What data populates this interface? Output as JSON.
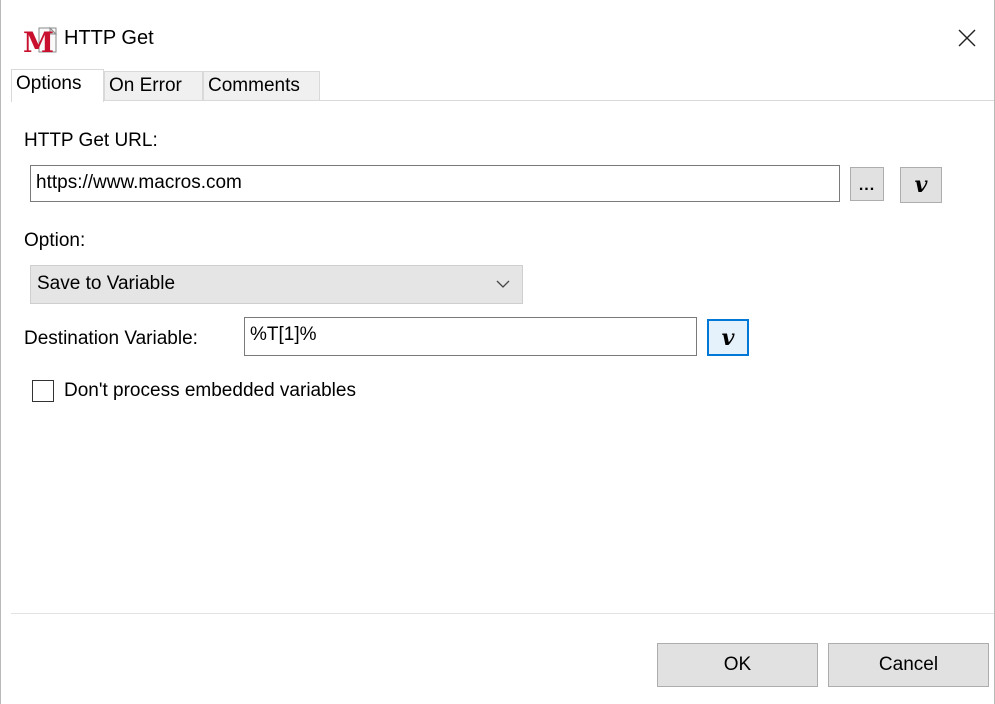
{
  "window": {
    "title": "HTTP Get",
    "app_icon": "macro-m-icon"
  },
  "tabs": [
    {
      "label": "Options",
      "active": true
    },
    {
      "label": "On Error",
      "active": false
    },
    {
      "label": "Comments",
      "active": false
    }
  ],
  "options": {
    "url_label": "HTTP Get URL:",
    "url_value": "https://www.macros.com",
    "browse_button": "...",
    "variable_button": "v",
    "option_label": "Option:",
    "option_selected": "Save to Variable",
    "dest_label": "Destination Variable:",
    "dest_value": "%T[1]%",
    "checkbox_label": "Don't process embedded variables",
    "checkbox_checked": false
  },
  "footer": {
    "ok_label": "OK",
    "cancel_label": "Cancel"
  },
  "colors": {
    "focus_border": "#0078d7",
    "button_face": "#e1e1e1",
    "combo_face": "#e5e5e5",
    "icon_red": "#c8102e"
  }
}
